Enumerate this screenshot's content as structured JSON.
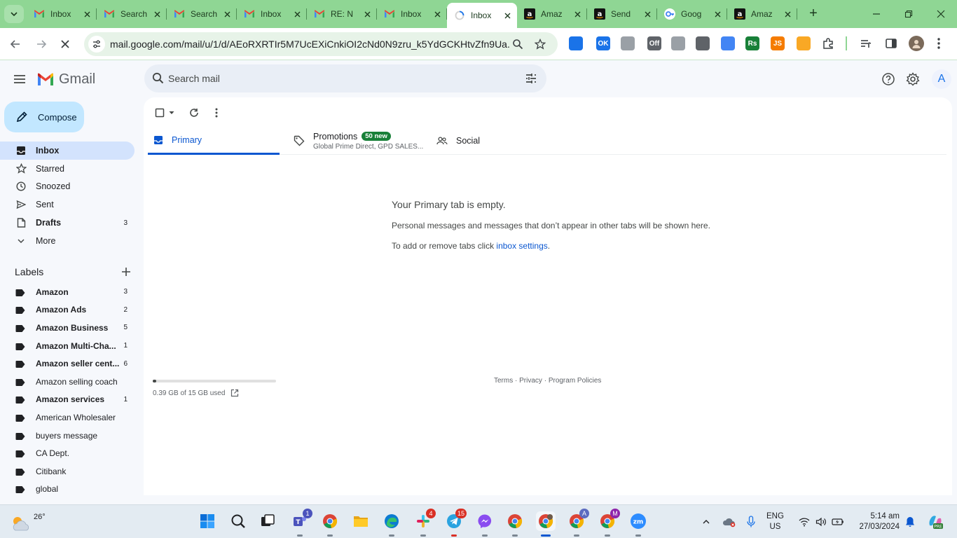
{
  "browser": {
    "tabs": [
      {
        "title": "Inbox",
        "icon": "gmail-icon",
        "active": false
      },
      {
        "title": "Search",
        "icon": "gmail-icon",
        "active": false
      },
      {
        "title": "Search",
        "icon": "gmail-icon",
        "active": false
      },
      {
        "title": "Inbox",
        "icon": "gmail-icon",
        "active": false
      },
      {
        "title": "RE: N",
        "icon": "gmail-icon",
        "active": false
      },
      {
        "title": "Inbox",
        "icon": "gmail-icon",
        "active": false
      },
      {
        "title": "Inbox",
        "icon": "loading-icon",
        "active": true
      },
      {
        "title": "Amaz",
        "icon": "amazon-icon",
        "active": false
      },
      {
        "title": "Send",
        "icon": "amazon-icon",
        "active": false
      },
      {
        "title": "Goog",
        "icon": "google-icon",
        "active": false
      },
      {
        "title": "Amaz",
        "icon": "amazon-icon",
        "active": false
      }
    ],
    "url": "mail.google.com/mail/u/1/d/AEoRXRTIr5M7UcEXiCnkiOI2cNd0N9zru_k5YdGCKHtvZfn9Ua...",
    "extensions": [
      {
        "name": "ext-plus-icon",
        "label": "",
        "color": "#1a73e8"
      },
      {
        "name": "ext-ok-icon",
        "label": "OK",
        "color": "#1a73e8"
      },
      {
        "name": "ext-tools-icon",
        "label": "",
        "color": "#9aa0a6"
      },
      {
        "name": "ext-off-icon",
        "label": "Off",
        "color": "#5f6368"
      },
      {
        "name": "ext-globe-icon",
        "label": "",
        "color": "#9aa0a6"
      },
      {
        "name": "ext-qr-icon",
        "label": "",
        "color": "#5f6368"
      },
      {
        "name": "ext-box-icon",
        "label": "",
        "color": "#4285f4"
      },
      {
        "name": "ext-rs-icon",
        "label": "Rs",
        "color": "#188038"
      },
      {
        "name": "ext-js-icon",
        "label": "JS",
        "color": "#f57c00"
      },
      {
        "name": "ext-orange-icon",
        "label": "",
        "color": "#f9a825"
      }
    ]
  },
  "gmail": {
    "logo_text": "Gmail",
    "search_placeholder": "Search mail",
    "avatar_letter": "A",
    "compose_label": "Compose",
    "nav": [
      {
        "label": "Inbox",
        "count": "",
        "icon": "inbox-icon",
        "active": true,
        "bold": true
      },
      {
        "label": "Starred",
        "count": "",
        "icon": "star-icon",
        "active": false,
        "bold": false
      },
      {
        "label": "Snoozed",
        "count": "",
        "icon": "clock-icon",
        "active": false,
        "bold": false
      },
      {
        "label": "Sent",
        "count": "",
        "icon": "send-icon",
        "active": false,
        "bold": false
      },
      {
        "label": "Drafts",
        "count": "3",
        "icon": "draft-icon",
        "active": false,
        "bold": true
      },
      {
        "label": "More",
        "count": "",
        "icon": "chevron-down-icon",
        "active": false,
        "bold": false
      }
    ],
    "labels_title": "Labels",
    "labels": [
      {
        "label": "Amazon",
        "count": "3",
        "bold": true
      },
      {
        "label": "Amazon Ads",
        "count": "2",
        "bold": true
      },
      {
        "label": "Amazon Business",
        "count": "5",
        "bold": true
      },
      {
        "label": "Amazon Multi-Cha...",
        "count": "1",
        "bold": true
      },
      {
        "label": "Amazon seller cent...",
        "count": "6",
        "bold": true
      },
      {
        "label": "Amazon selling coach",
        "count": "",
        "bold": false
      },
      {
        "label": "Amazon services",
        "count": "1",
        "bold": true
      },
      {
        "label": "American Wholesaler",
        "count": "",
        "bold": false
      },
      {
        "label": "buyers message",
        "count": "",
        "bold": false
      },
      {
        "label": "CA Dept.",
        "count": "",
        "bold": false
      },
      {
        "label": "Citibank",
        "count": "",
        "bold": false
      },
      {
        "label": "global",
        "count": "",
        "bold": false
      }
    ],
    "inbox_tabs": {
      "primary": "Primary",
      "promotions": "Promotions",
      "promotions_badge": "50 new",
      "promotions_sub": "Global Prime Direct, GPD SALES...",
      "social": "Social"
    },
    "empty": {
      "title": "Your Primary tab is empty.",
      "line1": "Personal messages and messages that don’t appear in other tabs will be shown here.",
      "line2_prefix": "To add or remove tabs click ",
      "line2_link": "inbox settings",
      "line2_suffix": "."
    },
    "storage": {
      "text": "0.39 GB of 15 GB used",
      "fraction": 0.026
    },
    "footer": {
      "terms": "Terms",
      "sep": " · ",
      "privacy": "Privacy",
      "policies": "Program Policies"
    }
  },
  "taskbar": {
    "temperature": "26°",
    "apps": [
      {
        "name": "start-icon",
        "badge": ""
      },
      {
        "name": "search-icon",
        "badge": ""
      },
      {
        "name": "task-view-icon",
        "badge": ""
      },
      {
        "name": "teams-icon",
        "badge": "1"
      },
      {
        "name": "chrome-icon",
        "badge": ""
      },
      {
        "name": "file-explorer-icon",
        "badge": ""
      },
      {
        "name": "edge-icon",
        "badge": ""
      },
      {
        "name": "slack-icon",
        "badge": "4"
      },
      {
        "name": "telegram-icon",
        "badge": "15"
      },
      {
        "name": "messenger-icon",
        "badge": ""
      },
      {
        "name": "chrome-icon-2",
        "badge": ""
      },
      {
        "name": "chrome-profile-icon-1",
        "badge": ""
      },
      {
        "name": "chrome-profile-icon-a",
        "badge": "A"
      },
      {
        "name": "chrome-profile-icon-m",
        "badge": "M"
      },
      {
        "name": "zoom-icon",
        "badge": ""
      }
    ],
    "language": "ENG",
    "region": "US",
    "time": "5:14 am",
    "date": "27/03/2024"
  }
}
